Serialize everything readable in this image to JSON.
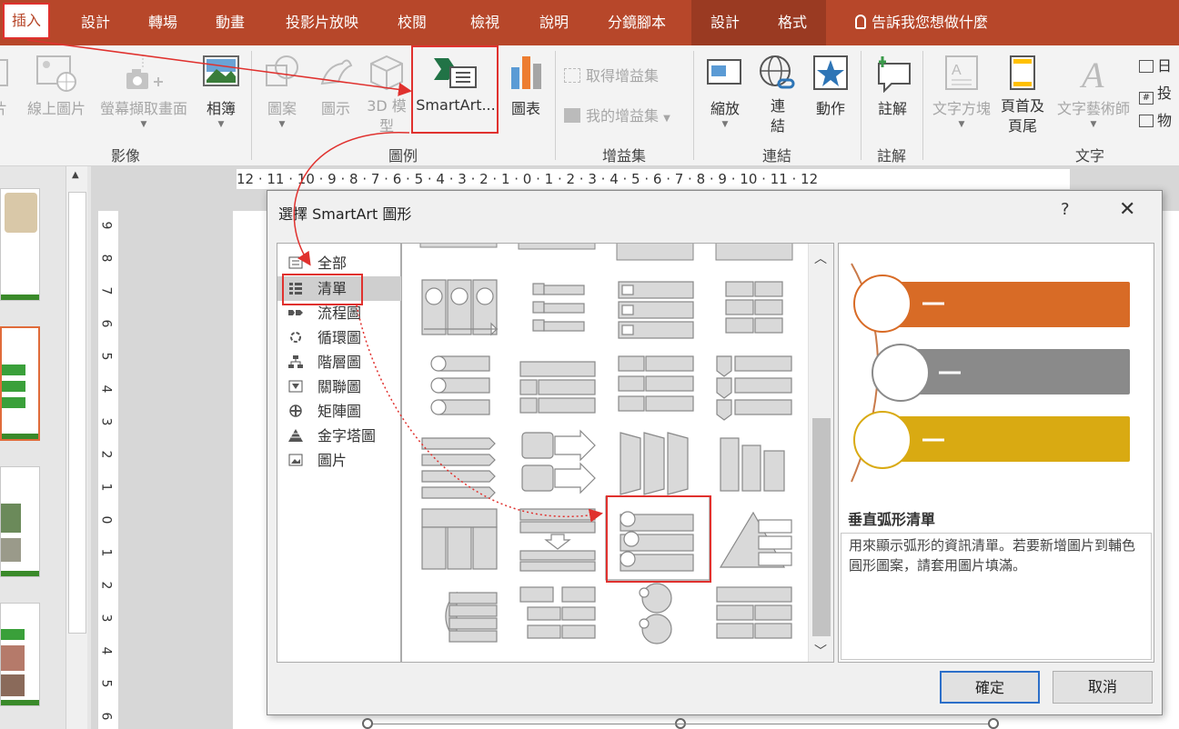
{
  "tabs": [
    {
      "label": "插入",
      "active": true
    },
    {
      "label": "設計"
    },
    {
      "label": "轉場"
    },
    {
      "label": "動畫"
    },
    {
      "label": "投影片放映"
    },
    {
      "label": "校閱"
    },
    {
      "label": "檢視"
    },
    {
      "label": "說明"
    },
    {
      "label": "分鏡腳本"
    },
    {
      "label": "設計",
      "contextual": true
    },
    {
      "label": "格式",
      "contextual": true
    }
  ],
  "tell_me": "告訴我您想做什麼",
  "ribbon": {
    "images_group": {
      "label": "影像",
      "pictures_cut": "片",
      "online_pictures": "線上圖片",
      "screenshot": "螢幕擷取畫面",
      "album": "相簿"
    },
    "illustrations_group": {
      "label": "圖例",
      "shapes": "圖案",
      "icons": "圖示",
      "models_3d_line1": "3D 模",
      "models_3d_line2": "型",
      "smartart": "SmartArt...",
      "chart": "圖表"
    },
    "addins_group": {
      "label": "增益集",
      "get_addins": "取得增益集",
      "my_addins": "我的增益集"
    },
    "links_group": {
      "label": "連結",
      "zoom": "縮放",
      "link_line1": "連",
      "link_line2": "結",
      "action": "動作"
    },
    "comments_group": {
      "label": "註解",
      "comment": "註解"
    },
    "text_group": {
      "label": "文字",
      "textbox": "文字方塊",
      "header_footer_line1": "頁首及",
      "header_footer_line2": "頁尾",
      "wordart": "文字藝術師",
      "date_cut": "日",
      "slide_number_cut": "投",
      "object_cut": "物"
    }
  },
  "ruler": {
    "horizontal": "12 · 11 · 10 · 9 · 8 · 7 · 6 · 5 · 4 · 3 · 2 · 1 · 0 · 1 · 2 · 3 · 4 · 5 · 6 · 7 · 8 · 9 · 10 · 11 · 12",
    "vertical": [
      "9",
      "8",
      "7",
      "6",
      "5",
      "4",
      "3",
      "2",
      "1",
      "0",
      "1",
      "2",
      "3",
      "4",
      "5",
      "6"
    ]
  },
  "dialog": {
    "title": "選擇 SmartArt 圖形",
    "help": "?",
    "close": "✕",
    "categories": [
      {
        "label": "全部"
      },
      {
        "label": "清單",
        "selected": true
      },
      {
        "label": "流程圖"
      },
      {
        "label": "循環圖"
      },
      {
        "label": "階層圖"
      },
      {
        "label": "關聯圖"
      },
      {
        "label": "矩陣圖"
      },
      {
        "label": "金字塔圖"
      },
      {
        "label": "圖片"
      }
    ],
    "preview": {
      "name": "垂直弧形清單",
      "description": "用來顯示弧形的資訊清單。若要新增圖片到輔色圓形圖案，請套用圖片填滿。",
      "bar_colors": [
        "#d86b26",
        "#8a8a8a",
        "#d9aa12"
      ]
    },
    "ok": "確定",
    "cancel": "取消"
  },
  "colors": {
    "ribbon_tab_bg": "#b7472a",
    "highlight": "#e0312e"
  }
}
